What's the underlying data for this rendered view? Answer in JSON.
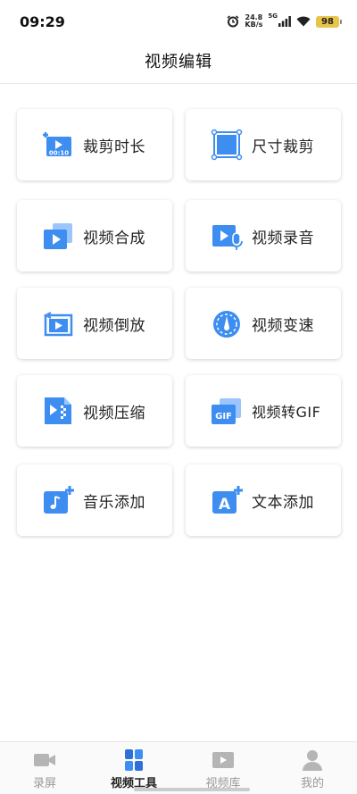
{
  "status_bar": {
    "time": "09:29",
    "net_speed_value": "24.8",
    "net_speed_unit": "KB/s",
    "network_type": "5G",
    "battery": "98"
  },
  "header": {
    "title": "视频编辑"
  },
  "tools": [
    {
      "label": "裁剪时长",
      "icon": "trim-duration-icon",
      "badge": "00:10"
    },
    {
      "label": "尺寸裁剪",
      "icon": "crop-size-icon"
    },
    {
      "label": "视频合成",
      "icon": "video-merge-icon"
    },
    {
      "label": "视频录音",
      "icon": "video-record-audio-icon"
    },
    {
      "label": "视频倒放",
      "icon": "video-reverse-icon"
    },
    {
      "label": "视频变速",
      "icon": "video-speed-icon"
    },
    {
      "label": "视频压缩",
      "icon": "video-compress-icon"
    },
    {
      "label": "视频转GIF",
      "icon": "video-to-gif-icon",
      "badge": "GIF"
    },
    {
      "label": "音乐添加",
      "icon": "add-music-icon"
    },
    {
      "label": "文本添加",
      "icon": "add-text-icon",
      "badge": "A"
    }
  ],
  "bottom_nav": [
    {
      "label": "录屏",
      "icon": "screen-record-icon",
      "active": false
    },
    {
      "label": "视频工具",
      "icon": "video-tools-icon",
      "active": true
    },
    {
      "label": "视频库",
      "icon": "video-library-icon",
      "active": false
    },
    {
      "label": "我的",
      "icon": "profile-icon",
      "active": false
    }
  ],
  "colors": {
    "accent": "#3d8ef0",
    "accent_dark": "#2f6fd8",
    "inactive": "#b5b5b5"
  }
}
